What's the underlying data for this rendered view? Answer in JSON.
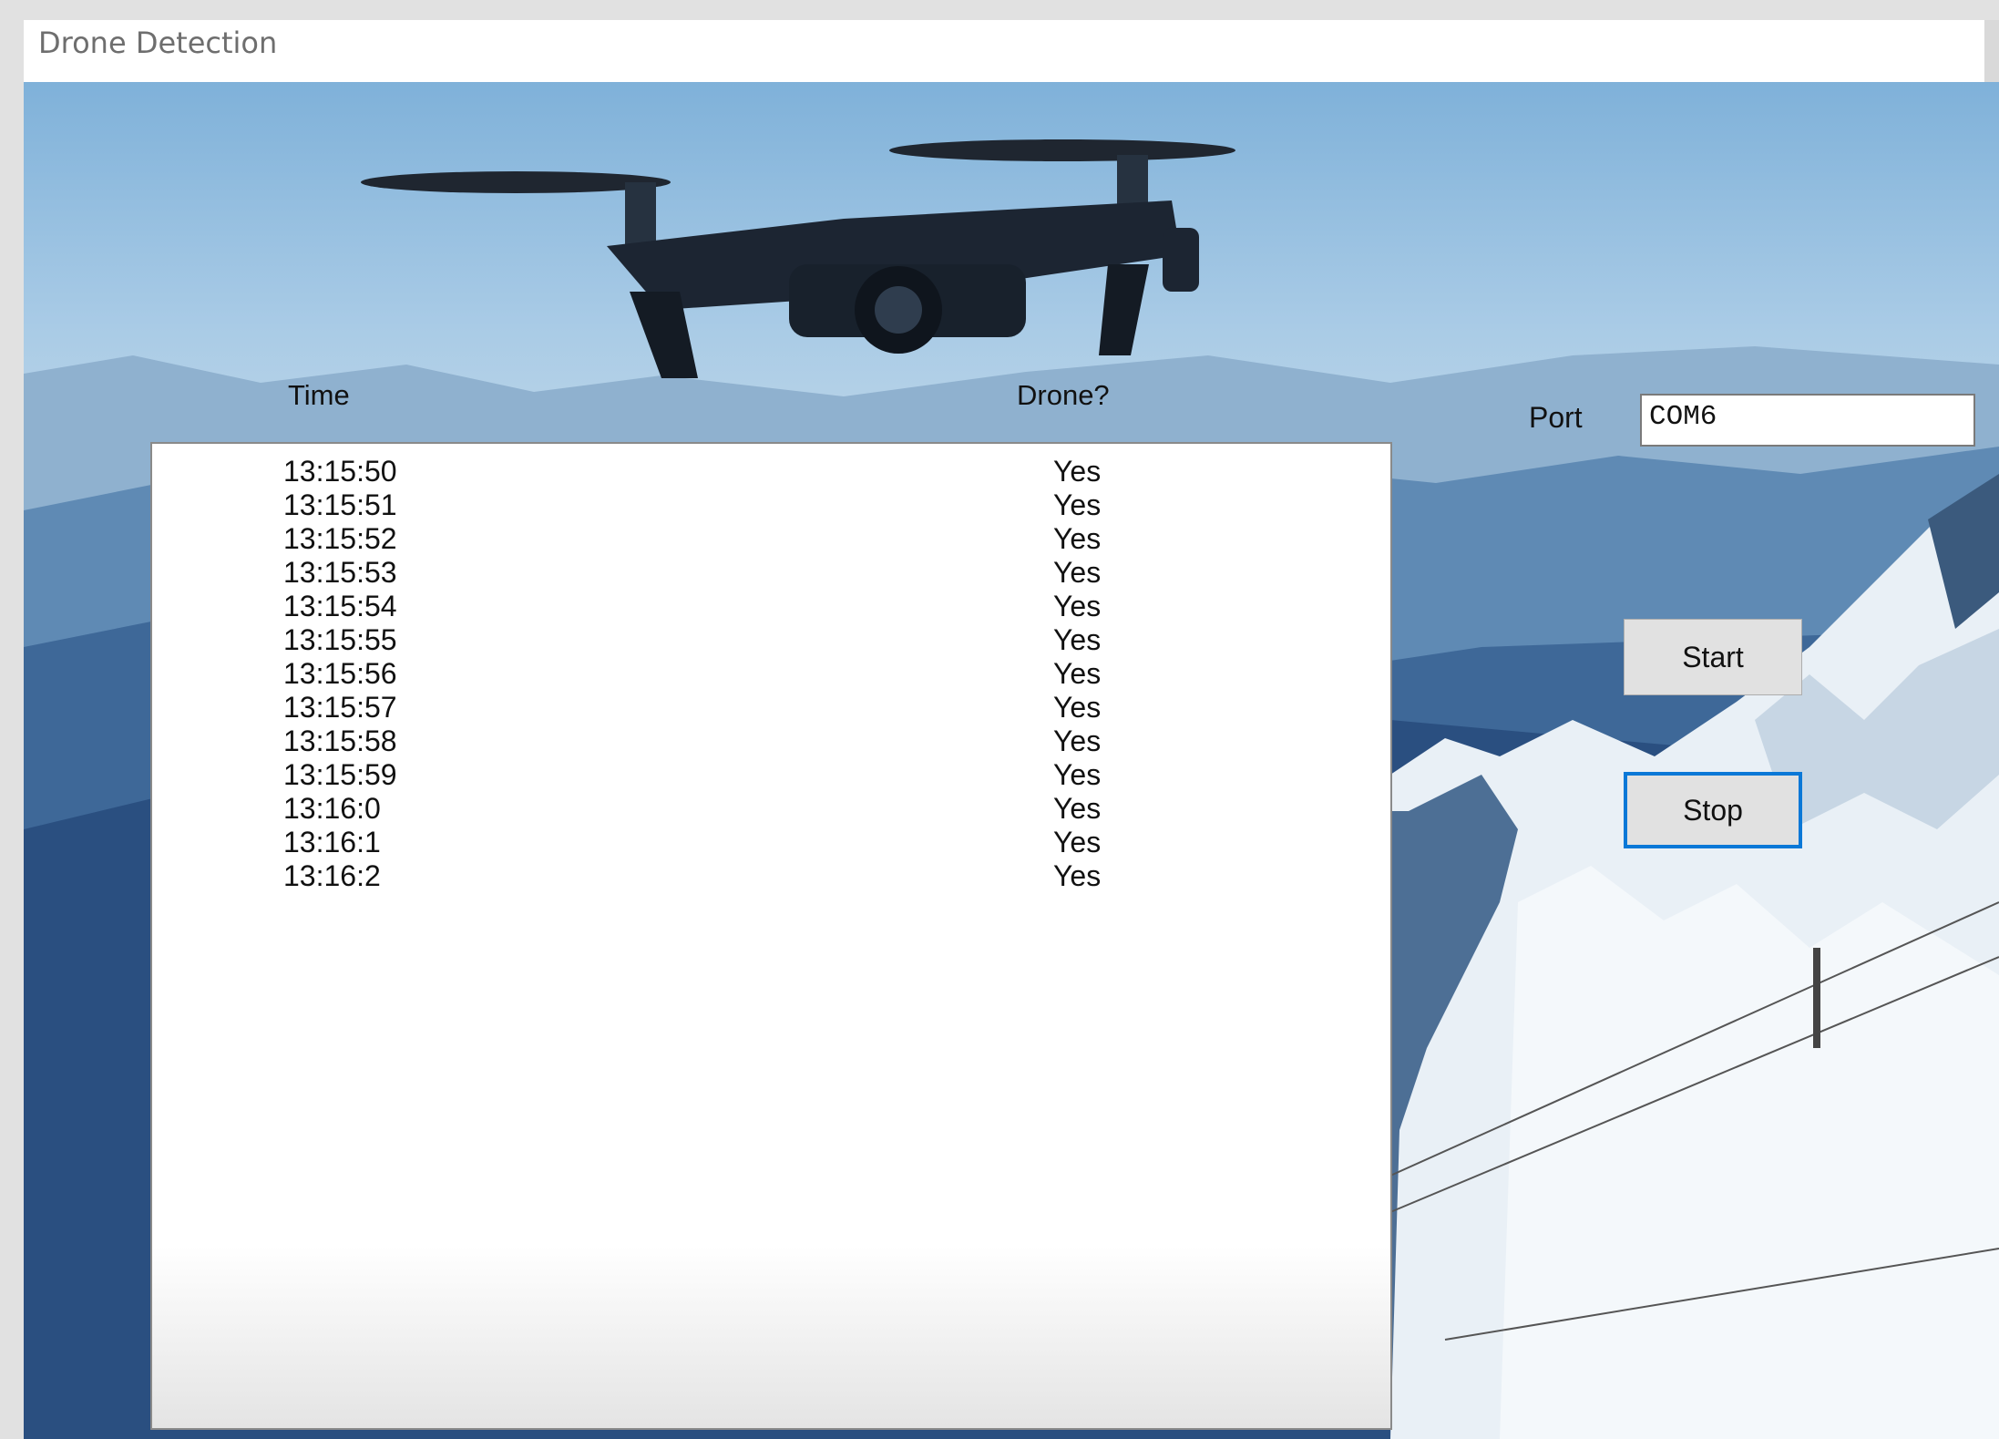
{
  "window": {
    "title": "Drone Detection"
  },
  "columns": {
    "time": "Time",
    "drone": "Drone?"
  },
  "rows": [
    {
      "time": "13:15:50",
      "drone": "Yes"
    },
    {
      "time": "13:15:51",
      "drone": "Yes"
    },
    {
      "time": "13:15:52",
      "drone": "Yes"
    },
    {
      "time": "13:15:53",
      "drone": "Yes"
    },
    {
      "time": "13:15:54",
      "drone": "Yes"
    },
    {
      "time": "13:15:55",
      "drone": "Yes"
    },
    {
      "time": "13:15:56",
      "drone": "Yes"
    },
    {
      "time": "13:15:57",
      "drone": "Yes"
    },
    {
      "time": "13:15:58",
      "drone": "Yes"
    },
    {
      "time": "13:15:59",
      "drone": "Yes"
    },
    {
      "time": "13:16:0",
      "drone": "Yes"
    },
    {
      "time": "13:16:1",
      "drone": "Yes"
    },
    {
      "time": "13:16:2",
      "drone": "Yes"
    }
  ],
  "port": {
    "label": "Port",
    "value": "COM6"
  },
  "buttons": {
    "start": "Start",
    "stop": "Stop"
  },
  "colors": {
    "focus_border": "#0a78d7",
    "button_face": "#e1e1e1"
  }
}
